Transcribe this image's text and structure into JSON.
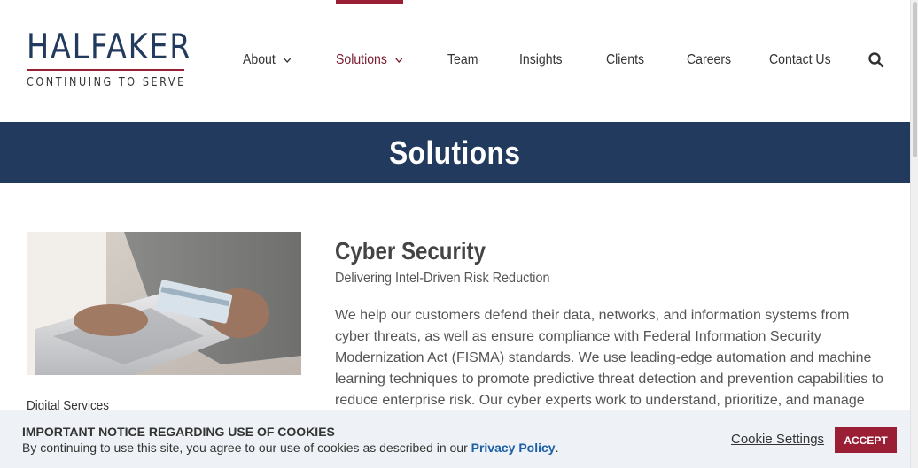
{
  "brand": {
    "name": "HALFAKER",
    "tagline": "CONTINUING TO SERVE",
    "primary_color": "#223a5e",
    "accent_color": "#9b1f34"
  },
  "nav": {
    "items": [
      {
        "label": "About",
        "has_dropdown": true
      },
      {
        "label": "Solutions",
        "has_dropdown": true,
        "active": true
      },
      {
        "label": "Team"
      },
      {
        "label": "Insights"
      },
      {
        "label": "Clients"
      },
      {
        "label": "Careers"
      },
      {
        "label": "Contact Us"
      }
    ],
    "search_icon": "search-icon"
  },
  "banner": {
    "title": "Solutions"
  },
  "sidebar": {
    "image": "laptop-credit-card-photo",
    "link_label": "Digital Services"
  },
  "content": {
    "title": "Cyber Security",
    "subtitle": "Delivering Intel-Driven Risk Reduction",
    "body": "We help our customers defend their data, networks, and information systems from cyber threats, as well as ensure compliance with Federal Information Security Modernization Act (FISMA) standards. We use leading-edge automation and machine learning techniques to promote predictive threat detection and prevention capabilities to reduce enterprise risk. Our cyber experts work to understand, prioritize, and manage"
  },
  "cookie_banner": {
    "title": "IMPORTANT NOTICE REGARDING USE OF COOKIES",
    "text_before_link": "By continuing to use this site, you agree to our use of cookies as described in our ",
    "link_label": "Privacy Policy",
    "text_after_link": ".",
    "settings_label": "Cookie Settings",
    "accept_label": "ACCEPT"
  }
}
